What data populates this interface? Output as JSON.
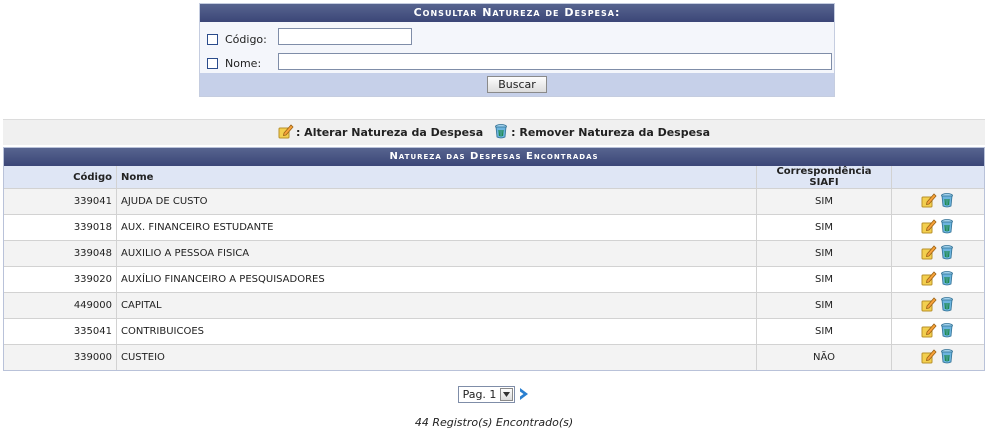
{
  "search": {
    "caption": "Consultar Natureza de Despesa:",
    "code_label": "Código:",
    "code_value": "",
    "name_label": "Nome:",
    "name_value": "",
    "button_label": "Buscar"
  },
  "legend": {
    "edit_label": ": Alterar Natureza da Despesa",
    "edit_icon": "edit-pencil-icon",
    "remove_label": ": Remover Natureza da Despesa",
    "remove_icon": "trash-bin-icon"
  },
  "results": {
    "caption": "Natureza das Despesas Encontradas",
    "columns": {
      "code": "Código",
      "name": "Nome",
      "siafi": "Correspondência SIAFI",
      "actions": ""
    },
    "rows": [
      {
        "code": "339041",
        "name": "AJUDA DE CUSTO",
        "siafi": "SIM"
      },
      {
        "code": "339018",
        "name": "AUX. FINANCEIRO ESTUDANTE",
        "siafi": "SIM"
      },
      {
        "code": "339048",
        "name": "AUXILIO A PESSOA FISICA",
        "siafi": "SIM"
      },
      {
        "code": "339020",
        "name": "AUXÍLIO FINANCEIRO A PESQUISADORES",
        "siafi": "SIM"
      },
      {
        "code": "449000",
        "name": "CAPITAL",
        "siafi": "SIM"
      },
      {
        "code": "335041",
        "name": "CONTRIBUICOES",
        "siafi": "SIM"
      },
      {
        "code": "339000",
        "name": "CUSTEIO",
        "siafi": "NÃO"
      }
    ]
  },
  "pagination": {
    "page_select": "Pag. 1",
    "next_icon": "next-arrow-icon"
  },
  "footer": {
    "record_count": "44 Registro(s) Encontrado(s)"
  },
  "colors": {
    "caption_bg": "#4a5685",
    "form_bg": "#f4f6fb",
    "footer_bar_bg": "#c6d0e9",
    "header_row_bg": "#dfe6f5",
    "odd_row_bg": "#f3f3f3"
  }
}
